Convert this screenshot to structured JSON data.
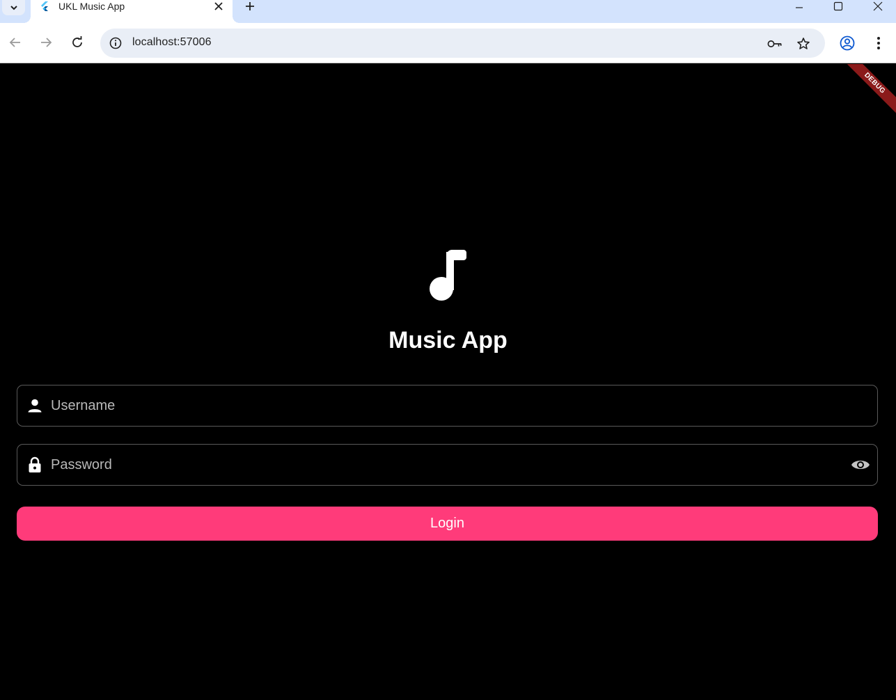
{
  "browser": {
    "tab_title": "UKL Music App",
    "url": "localhost:57006",
    "icons": [
      "tab-search-icon",
      "flutter-favicon-icon",
      "close-icon",
      "plus-icon",
      "minimize-icon",
      "maximize-icon",
      "close-window-icon",
      "back-arrow-icon",
      "forward-arrow-icon",
      "reload-icon",
      "site-info-icon",
      "password-key-icon",
      "bookmark-star-icon",
      "profile-icon",
      "more-vert-icon"
    ]
  },
  "app": {
    "debug_banner": "DEBUG",
    "logo_icon": "music-note-icon",
    "title": "Music App",
    "username": {
      "placeholder": "Username",
      "value": "",
      "icon": "person-icon"
    },
    "password": {
      "placeholder": "Password",
      "value": "",
      "icon": "lock-icon",
      "toggle_icon": "eye-icon"
    },
    "login_label": "Login"
  },
  "colors": {
    "background": "#000000",
    "accent": "#ff3b7a",
    "tabstrip": "#d3e3fd",
    "debug_ribbon": "#8b1a1a"
  }
}
